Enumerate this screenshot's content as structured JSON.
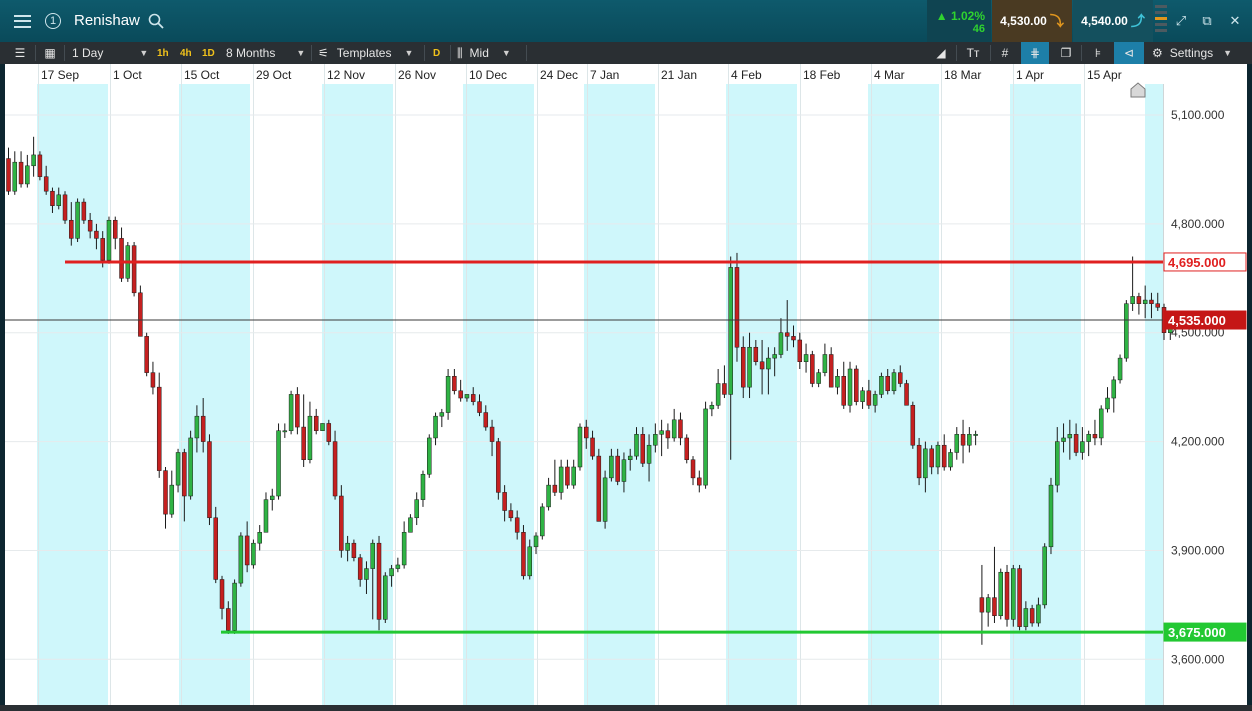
{
  "header": {
    "instrument": "Renishaw",
    "link_number": "1",
    "change_pct": "▲ 1.02%",
    "change_pts": "46",
    "sell_price": "4,530.00",
    "buy_price": "4,540.00",
    "colors": {
      "header_bg": "#0a4a5a",
      "up": "#2fd32f",
      "sell_arrow": "#e0961e",
      "buy_arrow": "#3fc3d8"
    },
    "icons": [
      "menu-icon",
      "link-icon",
      "search-icon",
      "price-level-icon",
      "expand-icon",
      "popout-icon",
      "close-icon"
    ]
  },
  "toolbar": {
    "interval": "1 Day",
    "quick_intervals": [
      "1h",
      "4h",
      "1D"
    ],
    "range": "8 Months",
    "templates": "Templates",
    "d_label": "D",
    "price_type": "Mid",
    "settings": "Settings",
    "icons": [
      "panel-icon",
      "layout-icon",
      "template-icon",
      "candle-icon",
      "trendline-icon",
      "text-icon",
      "grid-icon",
      "crosshair-icon",
      "layers-icon",
      "bar-style-icon",
      "marker-icon",
      "settings-icon"
    ]
  },
  "chart_data": {
    "type": "candlestick",
    "y_axis": {
      "ylim": [
        3550,
        5200
      ],
      "ticks": [
        3600,
        3900,
        4200,
        4500,
        4800,
        5100
      ],
      "tick_labels": [
        "3,600.000",
        "3,900.000",
        "4,200.000",
        "4,500.000",
        "4,800.000",
        "5,100.000"
      ],
      "position": "right"
    },
    "x_axis": {
      "labels": [
        "17 Sep",
        "1 Oct",
        "15 Oct",
        "29 Oct",
        "12 Nov",
        "26 Nov",
        "10 Dec",
        "24 Dec",
        "7 Jan",
        "21 Jan",
        "4 Feb",
        "18 Feb",
        "4 Mar",
        "18 Mar",
        "1 Apr",
        "15 Apr"
      ]
    },
    "grid": true,
    "colors": {
      "up": "#2fb344",
      "down": "#c52020",
      "band": "#cff7fb",
      "resistance": "#e02020",
      "support": "#22c832",
      "current_badge": "#c51616"
    },
    "lines": [
      {
        "kind": "resistance",
        "value": 4695,
        "label": "4,695.000"
      },
      {
        "kind": "support",
        "value": 3675,
        "label": "3,675.000"
      },
      {
        "kind": "current",
        "value": 4535,
        "label": "4,535.000"
      }
    ],
    "candles": [
      [
        4980,
        5010,
        4880,
        4890
      ],
      [
        4890,
        5000,
        4880,
        4970
      ],
      [
        4970,
        5000,
        4900,
        4910
      ],
      [
        4910,
        4990,
        4900,
        4960
      ],
      [
        4960,
        5040,
        4930,
        4990
      ],
      [
        4990,
        5000,
        4920,
        4930
      ],
      [
        4930,
        4960,
        4880,
        4890
      ],
      [
        4890,
        4900,
        4830,
        4850
      ],
      [
        4850,
        4900,
        4840,
        4880
      ],
      [
        4880,
        4890,
        4800,
        4810
      ],
      [
        4810,
        4860,
        4740,
        4760
      ],
      [
        4760,
        4870,
        4750,
        4860
      ],
      [
        4860,
        4870,
        4800,
        4810
      ],
      [
        4810,
        4830,
        4760,
        4780
      ],
      [
        4780,
        4800,
        4730,
        4760
      ],
      [
        4760,
        4780,
        4680,
        4700
      ],
      [
        4700,
        4820,
        4690,
        4810
      ],
      [
        4810,
        4820,
        4730,
        4760
      ],
      [
        4760,
        4790,
        4640,
        4650
      ],
      [
        4650,
        4750,
        4640,
        4740
      ],
      [
        4740,
        4750,
        4600,
        4610
      ],
      [
        4610,
        4630,
        4490,
        4490
      ],
      [
        4490,
        4500,
        4380,
        4390
      ],
      [
        4390,
        4420,
        4330,
        4350
      ],
      [
        4350,
        4390,
        4100,
        4120
      ],
      [
        4120,
        4130,
        3960,
        4000
      ],
      [
        4000,
        4120,
        3990,
        4080
      ],
      [
        4080,
        4180,
        4060,
        4170
      ],
      [
        4170,
        4180,
        3980,
        4050
      ],
      [
        4050,
        4230,
        4040,
        4210
      ],
      [
        4210,
        4300,
        4170,
        4270
      ],
      [
        4270,
        4320,
        4170,
        4200
      ],
      [
        4200,
        4220,
        3970,
        3990
      ],
      [
        3990,
        4020,
        3810,
        3820
      ],
      [
        3820,
        3830,
        3710,
        3740
      ],
      [
        3740,
        3760,
        3670,
        3680
      ],
      [
        3680,
        3820,
        3670,
        3810
      ],
      [
        3810,
        3950,
        3800,
        3940
      ],
      [
        3940,
        3980,
        3840,
        3860
      ],
      [
        3860,
        3930,
        3850,
        3920
      ],
      [
        3920,
        3970,
        3900,
        3950
      ],
      [
        3950,
        4060,
        3950,
        4040
      ],
      [
        4040,
        4070,
        4010,
        4050
      ],
      [
        4050,
        4250,
        4040,
        4230
      ],
      [
        4230,
        4250,
        4210,
        4230
      ],
      [
        4230,
        4340,
        4220,
        4330
      ],
      [
        4330,
        4350,
        4220,
        4240
      ],
      [
        4240,
        4330,
        4130,
        4150
      ],
      [
        4150,
        4310,
        4140,
        4270
      ],
      [
        4270,
        4290,
        4220,
        4230
      ],
      [
        4230,
        4250,
        4230,
        4250
      ],
      [
        4250,
        4260,
        4190,
        4200
      ],
      [
        4200,
        4230,
        4040,
        4050
      ],
      [
        4050,
        4080,
        3880,
        3900
      ],
      [
        3900,
        3940,
        3870,
        3920
      ],
      [
        3920,
        3930,
        3870,
        3880
      ],
      [
        3880,
        3890,
        3800,
        3820
      ],
      [
        3820,
        3870,
        3780,
        3850
      ],
      [
        3850,
        3930,
        3710,
        3920
      ],
      [
        3920,
        3940,
        3680,
        3710
      ],
      [
        3710,
        3840,
        3700,
        3830
      ],
      [
        3830,
        3860,
        3800,
        3850
      ],
      [
        3850,
        3880,
        3840,
        3860
      ],
      [
        3860,
        3980,
        3850,
        3950
      ],
      [
        3950,
        4000,
        3950,
        3990
      ],
      [
        3990,
        4060,
        3970,
        4040
      ],
      [
        4040,
        4120,
        4020,
        4110
      ],
      [
        4110,
        4220,
        4100,
        4210
      ],
      [
        4210,
        4280,
        4190,
        4270
      ],
      [
        4270,
        4290,
        4240,
        4280
      ],
      [
        4280,
        4400,
        4260,
        4380
      ],
      [
        4380,
        4400,
        4330,
        4340
      ],
      [
        4340,
        4370,
        4310,
        4320
      ],
      [
        4320,
        4330,
        4310,
        4330
      ],
      [
        4330,
        4350,
        4300,
        4310
      ],
      [
        4310,
        4330,
        4270,
        4280
      ],
      [
        4280,
        4300,
        4230,
        4240
      ],
      [
        4240,
        4260,
        4160,
        4200
      ],
      [
        4200,
        4210,
        4040,
        4060
      ],
      [
        4060,
        4080,
        3980,
        4010
      ],
      [
        4010,
        4030,
        3980,
        3990
      ],
      [
        3990,
        4010,
        3930,
        3950
      ],
      [
        3950,
        3970,
        3820,
        3830
      ],
      [
        3830,
        3930,
        3820,
        3910
      ],
      [
        3910,
        3950,
        3890,
        3940
      ],
      [
        3940,
        4030,
        3930,
        4020
      ],
      [
        4020,
        4100,
        4010,
        4080
      ],
      [
        4080,
        4150,
        4050,
        4060
      ],
      [
        4060,
        4150,
        4040,
        4130
      ],
      [
        4130,
        4150,
        4070,
        4080
      ],
      [
        4080,
        4150,
        4070,
        4130
      ],
      [
        4130,
        4250,
        4120,
        4240
      ],
      [
        4240,
        4260,
        4180,
        4210
      ],
      [
        4210,
        4230,
        4150,
        4160
      ],
      [
        4160,
        4180,
        3980,
        3980
      ],
      [
        3980,
        4120,
        3960,
        4100
      ],
      [
        4100,
        4180,
        4090,
        4160
      ],
      [
        4160,
        4180,
        4080,
        4090
      ],
      [
        4090,
        4170,
        4060,
        4150
      ],
      [
        4150,
        4180,
        4120,
        4160
      ],
      [
        4160,
        4240,
        4150,
        4220
      ],
      [
        4220,
        4240,
        4130,
        4140
      ],
      [
        4140,
        4220,
        4090,
        4190
      ],
      [
        4190,
        4250,
        4170,
        4220
      ],
      [
        4220,
        4260,
        4160,
        4230
      ],
      [
        4230,
        4250,
        4180,
        4210
      ],
      [
        4210,
        4290,
        4200,
        4260
      ],
      [
        4260,
        4280,
        4190,
        4210
      ],
      [
        4210,
        4220,
        4140,
        4150
      ],
      [
        4150,
        4160,
        4080,
        4100
      ],
      [
        4100,
        4120,
        4060,
        4080
      ],
      [
        4080,
        4310,
        4070,
        4290
      ],
      [
        4290,
        4310,
        4270,
        4300
      ],
      [
        4300,
        4400,
        4290,
        4360
      ],
      [
        4360,
        4410,
        4320,
        4330
      ],
      [
        4330,
        4710,
        4150,
        4680
      ],
      [
        4680,
        4720,
        4420,
        4460
      ],
      [
        4460,
        4490,
        4320,
        4350
      ],
      [
        4350,
        4500,
        4320,
        4460
      ],
      [
        4460,
        4480,
        4410,
        4420
      ],
      [
        4420,
        4480,
        4330,
        4400
      ],
      [
        4400,
        4460,
        4330,
        4430
      ],
      [
        4430,
        4460,
        4380,
        4440
      ],
      [
        4440,
        4540,
        4430,
        4500
      ],
      [
        4500,
        4590,
        4450,
        4490
      ],
      [
        4490,
        4520,
        4460,
        4480
      ],
      [
        4480,
        4500,
        4400,
        4420
      ],
      [
        4420,
        4470,
        4390,
        4440
      ],
      [
        4440,
        4450,
        4350,
        4360
      ],
      [
        4360,
        4400,
        4350,
        4390
      ],
      [
        4390,
        4470,
        4380,
        4440
      ],
      [
        4440,
        4460,
        4350,
        4350
      ],
      [
        4350,
        4400,
        4330,
        4380
      ],
      [
        4380,
        4420,
        4290,
        4300
      ],
      [
        4300,
        4420,
        4280,
        4400
      ],
      [
        4400,
        4410,
        4300,
        4310
      ],
      [
        4310,
        4350,
        4290,
        4340
      ],
      [
        4340,
        4370,
        4290,
        4300
      ],
      [
        4300,
        4340,
        4280,
        4330
      ],
      [
        4330,
        4390,
        4320,
        4380
      ],
      [
        4380,
        4400,
        4330,
        4340
      ],
      [
        4340,
        4400,
        4330,
        4390
      ],
      [
        4390,
        4410,
        4350,
        4360
      ],
      [
        4360,
        4370,
        4310,
        4300
      ],
      [
        4300,
        4310,
        4180,
        4190
      ],
      [
        4190,
        4210,
        4080,
        4100
      ],
      [
        4100,
        4200,
        4060,
        4180
      ],
      [
        4180,
        4190,
        4110,
        4130
      ],
      [
        4130,
        4200,
        4110,
        4190
      ],
      [
        4190,
        4220,
        4120,
        4130
      ],
      [
        4130,
        4180,
        4120,
        4170
      ],
      [
        4170,
        4240,
        4150,
        4220
      ],
      [
        4220,
        4260,
        4140,
        4190
      ],
      [
        4190,
        4240,
        4170,
        4220
      ],
      [
        4220,
        4230,
        4190,
        4220
      ],
      [
        3770,
        3860,
        3640,
        3730
      ],
      [
        3730,
        3780,
        3690,
        3770
      ],
      [
        3770,
        3910,
        3700,
        3720
      ],
      [
        3720,
        3850,
        3710,
        3840
      ],
      [
        3840,
        3860,
        3690,
        3710
      ],
      [
        3710,
        3860,
        3690,
        3850
      ],
      [
        3850,
        3860,
        3680,
        3690
      ],
      [
        3690,
        3760,
        3680,
        3740
      ],
      [
        3740,
        3750,
        3690,
        3700
      ],
      [
        3700,
        3770,
        3690,
        3750
      ],
      [
        3750,
        3920,
        3740,
        3910
      ],
      [
        3910,
        4100,
        3890,
        4080
      ],
      [
        4080,
        4240,
        4060,
        4200
      ],
      [
        4200,
        4250,
        4170,
        4210
      ],
      [
        4210,
        4260,
        4150,
        4220
      ],
      [
        4220,
        4250,
        4160,
        4170
      ],
      [
        4170,
        4240,
        4150,
        4200
      ],
      [
        4200,
        4230,
        4160,
        4220
      ],
      [
        4220,
        4260,
        4190,
        4210
      ],
      [
        4210,
        4300,
        4190,
        4290
      ],
      [
        4290,
        4350,
        4280,
        4320
      ],
      [
        4320,
        4380,
        4280,
        4370
      ],
      [
        4370,
        4440,
        4360,
        4430
      ],
      [
        4430,
        4590,
        4420,
        4580
      ],
      [
        4580,
        4710,
        4560,
        4600
      ],
      [
        4600,
        4610,
        4550,
        4580
      ],
      [
        4580,
        4630,
        4540,
        4590
      ],
      [
        4590,
        4610,
        4540,
        4580
      ],
      [
        4580,
        4610,
        4560,
        4570
      ],
      [
        4570,
        4580,
        4480,
        4500
      ],
      [
        4500,
        4550,
        4480,
        4540
      ]
    ]
  }
}
